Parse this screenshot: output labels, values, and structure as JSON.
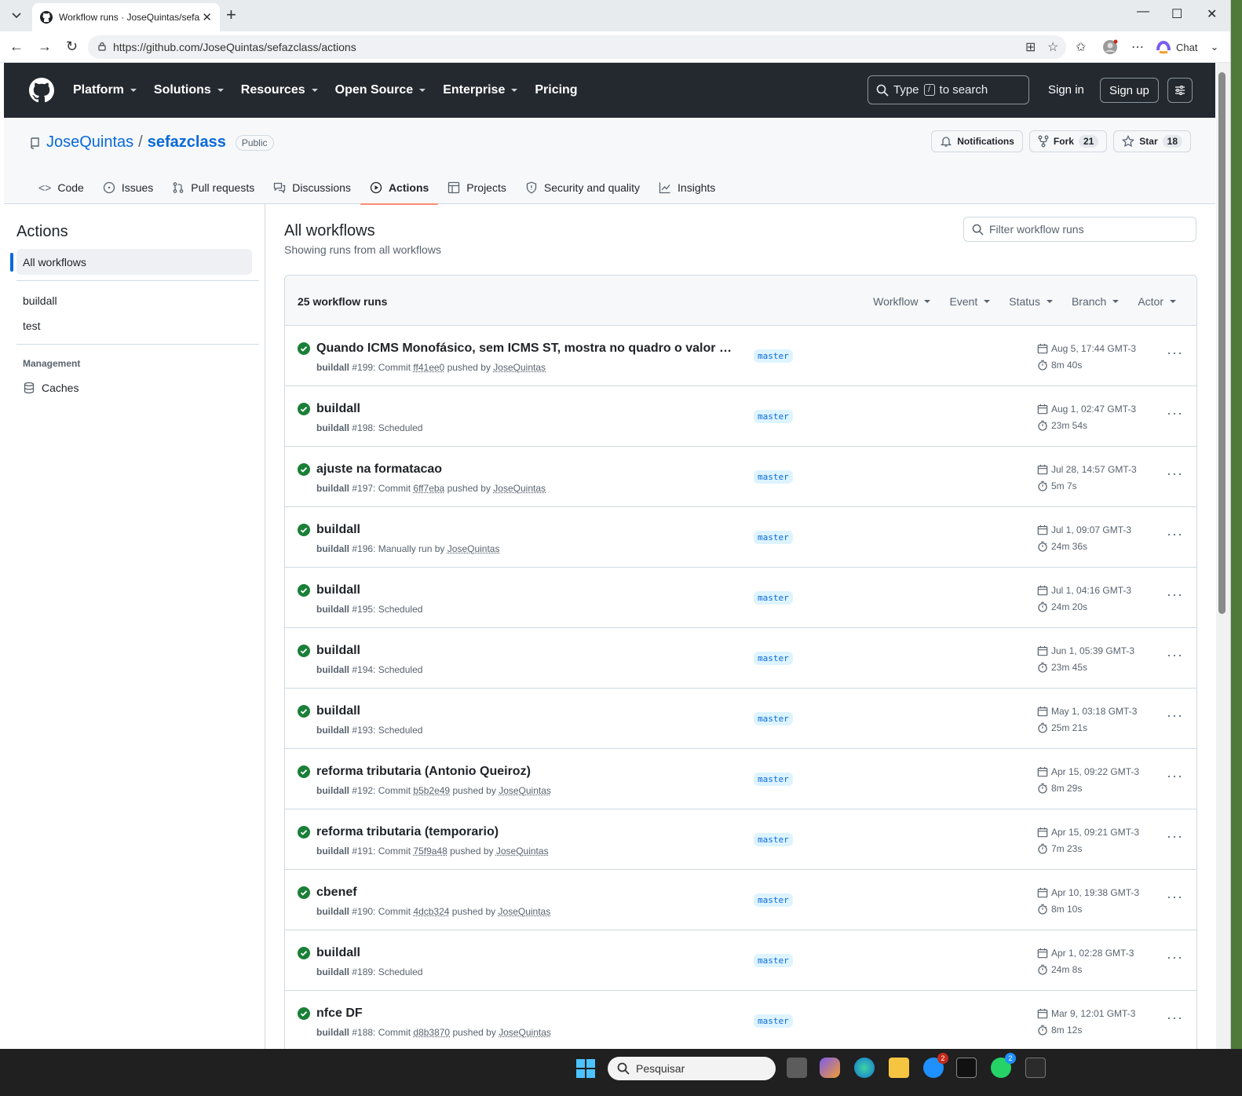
{
  "browser": {
    "tab_title": "Workflow runs · JoseQuintas/sefazclass",
    "url": "https://github.com/JoseQuintas/sefazclass/actions",
    "chat_label": "Chat"
  },
  "gh_header": {
    "nav": [
      "Platform",
      "Solutions",
      "Resources",
      "Open Source",
      "Enterprise",
      "Pricing"
    ],
    "search_type": "Type",
    "search_key": "/",
    "search_suffix": "to search",
    "sign_in": "Sign in",
    "sign_up": "Sign up"
  },
  "repo": {
    "owner": "JoseQuintas",
    "separator": "/",
    "name": "sefazclass",
    "visibility": "Public",
    "notifications_label": "Notifications",
    "fork_label": "Fork",
    "fork_count": "21",
    "star_label": "Star",
    "star_count": "18",
    "tabs": [
      "Code",
      "Issues",
      "Pull requests",
      "Discussions",
      "Actions",
      "Projects",
      "Security and quality",
      "Insights"
    ]
  },
  "sidebar": {
    "title": "Actions",
    "all_workflows": "All workflows",
    "workflows": [
      "buildall",
      "test"
    ],
    "management_label": "Management",
    "caches_label": "Caches"
  },
  "main": {
    "title": "All workflows",
    "subtitle": "Showing runs from all workflows",
    "filter_placeholder": "Filter workflow runs",
    "run_count": "25 workflow runs",
    "filters": [
      "Workflow",
      "Event",
      "Status",
      "Branch",
      "Actor"
    ]
  },
  "runs": [
    {
      "title": "Quando ICMS Monofásico, sem ICMS ST, mostra no quadro o valor (em...",
      "workflow": "buildall",
      "meta_num": "#199: Commit",
      "commit": "ff41ee0",
      "meta_mid": "pushed by",
      "actor": "JoseQuintas",
      "branch": "master",
      "date": "Aug 5, 17:44 GMT-3",
      "duration": "8m 40s"
    },
    {
      "title": "buildall",
      "workflow": "buildall",
      "meta_num": "#198: Scheduled",
      "commit": "",
      "meta_mid": "",
      "actor": "",
      "branch": "master",
      "date": "Aug 1, 02:47 GMT-3",
      "duration": "23m 54s"
    },
    {
      "title": "ajuste na formatacao",
      "workflow": "buildall",
      "meta_num": "#197: Commit",
      "commit": "6ff7eba",
      "meta_mid": "pushed by",
      "actor": "JoseQuintas",
      "branch": "master",
      "date": "Jul 28, 14:57 GMT-3",
      "duration": "5m 7s"
    },
    {
      "title": "buildall",
      "workflow": "buildall",
      "meta_num": "#196: Manually run by",
      "commit": "",
      "meta_mid": "",
      "actor": "JoseQuintas",
      "branch": "master",
      "date": "Jul 1, 09:07 GMT-3",
      "duration": "24m 36s"
    },
    {
      "title": "buildall",
      "workflow": "buildall",
      "meta_num": "#195: Scheduled",
      "commit": "",
      "meta_mid": "",
      "actor": "",
      "branch": "master",
      "date": "Jul 1, 04:16 GMT-3",
      "duration": "24m 20s"
    },
    {
      "title": "buildall",
      "workflow": "buildall",
      "meta_num": "#194: Scheduled",
      "commit": "",
      "meta_mid": "",
      "actor": "",
      "branch": "master",
      "date": "Jun 1, 05:39 GMT-3",
      "duration": "23m 45s"
    },
    {
      "title": "buildall",
      "workflow": "buildall",
      "meta_num": "#193: Scheduled",
      "commit": "",
      "meta_mid": "",
      "actor": "",
      "branch": "master",
      "date": "May 1, 03:18 GMT-3",
      "duration": "25m 21s"
    },
    {
      "title": "reforma tributaria (Antonio Queiroz)",
      "workflow": "buildall",
      "meta_num": "#192: Commit",
      "commit": "b5b2e49",
      "meta_mid": "pushed by",
      "actor": "JoseQuintas",
      "branch": "master",
      "date": "Apr 15, 09:22 GMT-3",
      "duration": "8m 29s"
    },
    {
      "title": "reforma tributaria (temporario)",
      "workflow": "buildall",
      "meta_num": "#191: Commit",
      "commit": "75f9a48",
      "meta_mid": "pushed by",
      "actor": "JoseQuintas",
      "branch": "master",
      "date": "Apr 15, 09:21 GMT-3",
      "duration": "7m 23s"
    },
    {
      "title": "cbenef",
      "workflow": "buildall",
      "meta_num": "#190: Commit",
      "commit": "4dcb324",
      "meta_mid": "pushed by",
      "actor": "JoseQuintas",
      "branch": "master",
      "date": "Apr 10, 19:38 GMT-3",
      "duration": "8m 10s"
    },
    {
      "title": "buildall",
      "workflow": "buildall",
      "meta_num": "#189: Scheduled",
      "commit": "",
      "meta_mid": "",
      "actor": "",
      "branch": "master",
      "date": "Apr 1, 02:28 GMT-3",
      "duration": "24m 8s"
    },
    {
      "title": "nfce DF",
      "workflow": "buildall",
      "meta_num": "#188: Commit",
      "commit": "d8b3870",
      "meta_mid": "pushed by",
      "actor": "JoseQuintas",
      "branch": "master",
      "date": "Mar 9, 12:01 GMT-3",
      "duration": "8m 12s"
    }
  ],
  "taskbar": {
    "search_placeholder": "Pesquisar",
    "badge_copilot": "2",
    "badge_whatsapp": "2"
  }
}
